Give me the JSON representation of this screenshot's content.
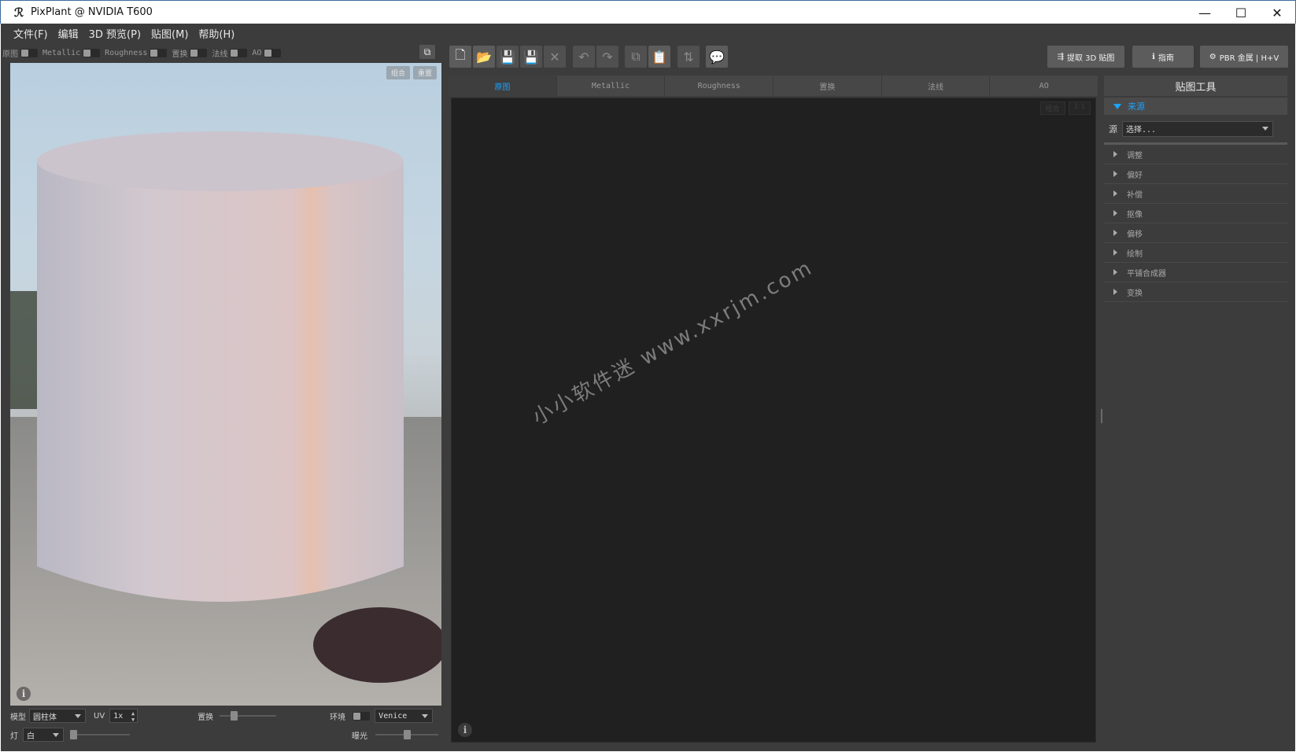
{
  "window": {
    "title": "PixPlant @ NVIDIA T600",
    "app_icon": "pixplant-logo-icon",
    "minimize": "—",
    "maximize": "☐",
    "close": "✕"
  },
  "menu": {
    "items": [
      "文件(F)",
      "编辑",
      "3D 预览(P)",
      "贴图(M)",
      "帮助(H)"
    ]
  },
  "channels": {
    "items": [
      "原图",
      "Metallic",
      "Roughness",
      "置换",
      "法线",
      "AO"
    ]
  },
  "viewport": {
    "badges": [
      "组合",
      "重置"
    ],
    "info": "i",
    "model_label": "模型",
    "model_value": "圆柱体",
    "uv_label": "UV",
    "uv_value": "1x",
    "displace_label": "置换",
    "env_label": "环境",
    "env_value": "Venice",
    "light_label": "灯",
    "light_value": "白",
    "exposure_label": "曝光"
  },
  "toolbar": {
    "buttons": [
      {
        "name": "new-file",
        "icon": "🗋"
      },
      {
        "name": "open-folder",
        "icon": "📂"
      },
      {
        "name": "save",
        "icon": "💾"
      },
      {
        "name": "save-all",
        "icon": "💾"
      },
      {
        "name": "close",
        "icon": "✕"
      },
      {
        "name": "undo",
        "icon": "↶"
      },
      {
        "name": "redo",
        "icon": "↷"
      },
      {
        "name": "copy",
        "icon": "⧉"
      },
      {
        "name": "paste",
        "icon": "📋"
      },
      {
        "name": "swap",
        "icon": "⇅"
      },
      {
        "name": "comment",
        "icon": "💬"
      }
    ],
    "extract_label": "提取 3D 贴图",
    "guide_label": "指南",
    "pbr_label": "PBR 金属 | H+V"
  },
  "tabs": [
    "原图",
    "Metallic",
    "Roughness",
    "置换",
    "法线",
    "AO"
  ],
  "canvas": {
    "badges": [
      "组合",
      "1:1"
    ],
    "info": "i",
    "watermark": "小小软件迷 www.xxrjm.com"
  },
  "right_panel": {
    "header": "贴图工具",
    "section": "来源",
    "source_label": "源",
    "source_value": "选择...",
    "items": [
      "调整",
      "偏好",
      "补偿",
      "抠像",
      "偏移",
      "绘制",
      "平铺合成器",
      "变换"
    ]
  }
}
